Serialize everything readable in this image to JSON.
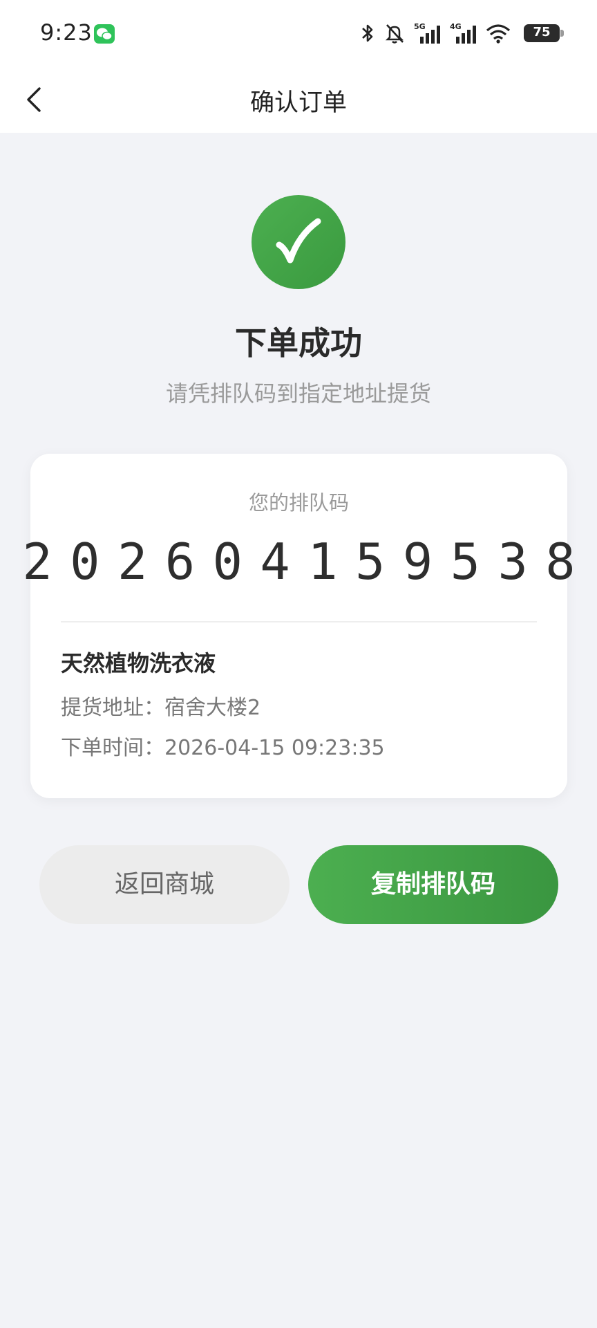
{
  "status_bar": {
    "time": "9:23",
    "battery": "75"
  },
  "header": {
    "title": "确认订单"
  },
  "result": {
    "title": "下单成功",
    "subtitle": "请凭排队码到指定地址提货"
  },
  "card": {
    "queue_label": "您的排队码",
    "queue_digits": [
      "2",
      "0",
      "2",
      "6",
      "0",
      "4",
      "1",
      "5",
      "9",
      "5",
      "3",
      "8"
    ],
    "product_name": "天然植物洗衣液",
    "address_label": "提货地址：",
    "address_value": "宿舍大楼2",
    "time_label": "下单时间：",
    "time_value": "2026-04-15 09:23:35"
  },
  "actions": {
    "back_label": "返回商城",
    "copy_label": "复制排队码"
  },
  "colors": {
    "accent": "#3fa244",
    "background": "#f2f3f7"
  }
}
